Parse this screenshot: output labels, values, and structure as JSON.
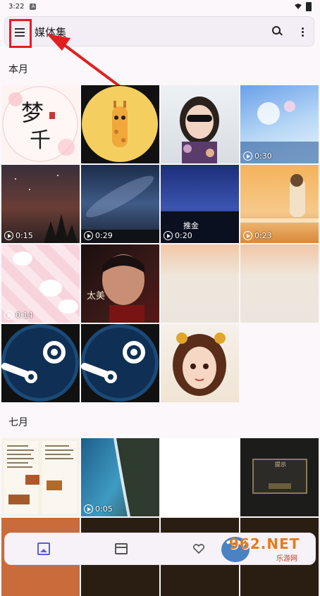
{
  "status_bar": {
    "time": "3:22",
    "badge": "A"
  },
  "app_bar": {
    "title": "媒体集",
    "search_icon": "search-icon",
    "more_icon": "more-vert-icon",
    "menu_icon": "hamburger-menu-icon"
  },
  "sections": [
    {
      "label": "本月",
      "items": [
        {
          "kind": "photo",
          "name": "calligraphy-art",
          "duration": ""
        },
        {
          "kind": "photo",
          "name": "giraffe-avatar",
          "duration": ""
        },
        {
          "kind": "photo",
          "name": "woman-selfie",
          "duration": ""
        },
        {
          "kind": "video",
          "name": "anime-sky",
          "duration": "0:30"
        },
        {
          "kind": "video",
          "name": "night-sky-trees",
          "duration": "0:15"
        },
        {
          "kind": "video",
          "name": "milky-way",
          "duration": "0:29"
        },
        {
          "kind": "video",
          "name": "blue-sky-text",
          "duration": "0:20",
          "overlay": "推金"
        },
        {
          "kind": "video",
          "name": "orange-anime",
          "duration": "0:23"
        },
        {
          "kind": "video",
          "name": "pink-pattern",
          "duration": "0:14"
        },
        {
          "kind": "photo",
          "name": "man-portrait",
          "duration": "",
          "overlay": "太美"
        },
        {
          "kind": "photo",
          "name": "beige-gradient-1",
          "duration": ""
        },
        {
          "kind": "photo",
          "name": "beige-gradient-2",
          "duration": ""
        },
        {
          "kind": "photo",
          "name": "steam-logo-1",
          "duration": ""
        },
        {
          "kind": "photo",
          "name": "steam-logo-2",
          "duration": ""
        },
        {
          "kind": "photo",
          "name": "anime-girl",
          "duration": ""
        }
      ]
    },
    {
      "label": "七月",
      "items": [
        {
          "kind": "photo",
          "name": "menu-document",
          "duration": ""
        },
        {
          "kind": "video",
          "name": "ocean-coast",
          "duration": "0:05"
        },
        {
          "kind": "photo",
          "name": "blank-white",
          "duration": ""
        },
        {
          "kind": "photo",
          "name": "dark-dialog",
          "duration": "",
          "overlay": "提示"
        }
      ]
    }
  ],
  "bottom_nav": {
    "items": [
      {
        "name": "photos-tab",
        "icon": "photos-icon",
        "selected": true
      },
      {
        "name": "videos-tab",
        "icon": "video-icon",
        "selected": false
      },
      {
        "name": "favorites-tab",
        "icon": "heart-icon",
        "selected": false
      }
    ]
  },
  "watermark": {
    "text": "962.NET",
    "sub": "乐游网"
  },
  "colors": {
    "background": "#fbf7fb",
    "accent": "#5b5fcf",
    "highlight": "#e51d25"
  }
}
